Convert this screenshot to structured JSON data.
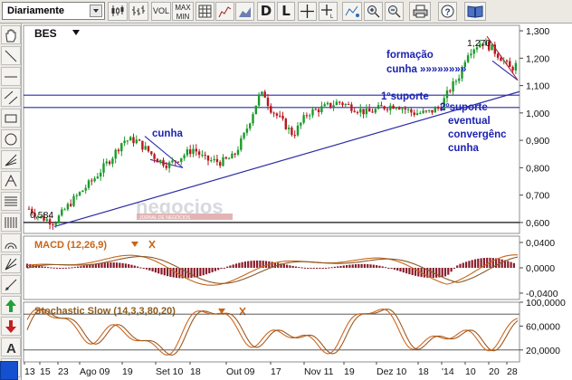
{
  "toolbar": {
    "period_select": "Diariamente",
    "vol_label": "VOL",
    "maxmin_label_1": "MAX",
    "maxmin_label_2": "MIN",
    "d_label": "D",
    "l_label": "L"
  },
  "chart": {
    "symbol": "BES",
    "y_ticks": [
      "1,300",
      "1,200",
      "1,100",
      "1,000",
      "0,900",
      "0,800",
      "0,700",
      "0,600"
    ],
    "price_high_label": "1,270",
    "price_low_label": "0,584",
    "watermark": "negocios",
    "watermark_sub": "JORNAL DE NEGÓCIOS",
    "x_ticks": [
      "13",
      "15",
      "23",
      "Ago 09",
      "19",
      "Set 10",
      "18",
      "Out 09",
      "17",
      "Nov 11",
      "19",
      "Dez 10",
      "18",
      "'14",
      "10",
      "20",
      "28"
    ],
    "annotations": {
      "cunha_left": "cunha",
      "formacao_line1": "formação",
      "formacao_line2": "cunha »»»»»»»»",
      "suporte1": "1ºsuporte",
      "suporte2": "2ºsuporte",
      "eventual_line1": "eventual",
      "eventual_line2": "convergênc",
      "eventual_line3": "cunha"
    },
    "colors": {
      "up": "#1a9b2a",
      "down": "#b81820",
      "trend": "#2c2ca8",
      "macd": "#c86418",
      "text_blue": "#1c22b0"
    }
  },
  "macd": {
    "title": "MACD (12,26,9)",
    "y_ticks": [
      "0,0400",
      "0,0000",
      "-0,0400"
    ]
  },
  "stochastic": {
    "title": "Stochastic Slow (14,3,3,80,20)",
    "y_ticks": [
      "100,0000",
      "60,0000",
      "20,0000"
    ]
  },
  "chart_data": {
    "type": "candlestick",
    "title": "BES",
    "ylim": [
      0.56,
      1.32
    ],
    "x": [
      "Jul 13",
      "Jul 15",
      "Jul 23",
      "Ago 09",
      "Ago 19",
      "Set 10",
      "Set 18",
      "Out 09",
      "Out 17",
      "Nov 11",
      "Nov 19",
      "Dez 10",
      "Dez 18",
      "Jan 02",
      "Jan 10",
      "Jan 20",
      "Jan 28"
    ],
    "close": [
      0.63,
      0.61,
      0.68,
      0.78,
      0.9,
      0.81,
      0.83,
      0.88,
      1.02,
      1.0,
      1.04,
      1.0,
      1.0,
      1.06,
      1.2,
      1.26,
      1.14
    ],
    "high_label": 1.27,
    "low_label": 0.584,
    "horizontal_lines": [
      1.065,
      1.02,
      0.6
    ],
    "macd_ylim": [
      -0.05,
      0.05
    ],
    "stochastic_ylim": [
      0,
      100
    ],
    "stochastic_levels": [
      80,
      20
    ]
  }
}
